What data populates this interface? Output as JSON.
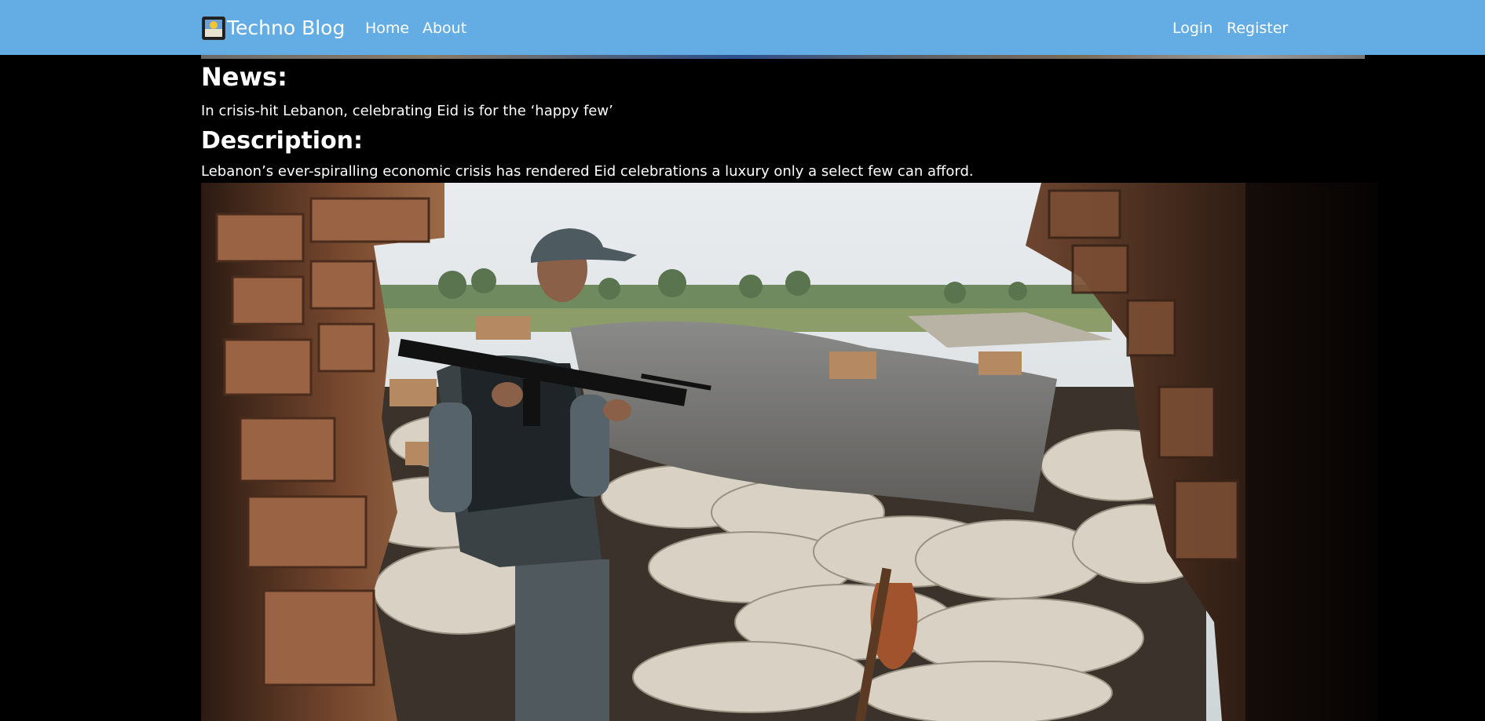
{
  "navbar": {
    "brand_label": "Techno Blog",
    "links_left": [
      {
        "label": "Home"
      },
      {
        "label": "About"
      }
    ],
    "links_right": [
      {
        "label": "Login"
      },
      {
        "label": "Register"
      }
    ],
    "background_color": "#64ade4"
  },
  "article": {
    "news_heading": "News:",
    "news_title": "In crisis-hit Lebanon, celebrating Eid is for the ‘happy few’",
    "description_heading": "Description:",
    "description_text": "Lebanon’s ever-spiralling economic crisis has rendered Eid celebrations a luxury only a select few can afford."
  },
  "page": {
    "background_color": "#000000"
  }
}
